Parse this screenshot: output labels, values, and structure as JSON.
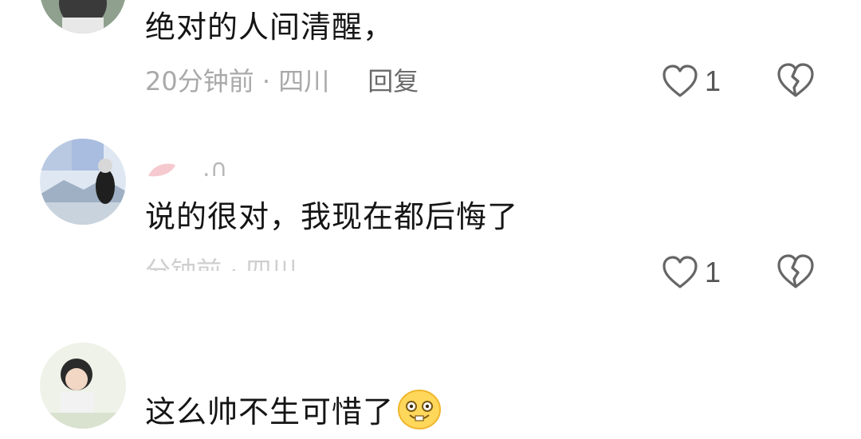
{
  "comments": [
    {
      "text": "绝对的人间清醒，",
      "time": "20分钟前",
      "location": "四川",
      "separator": " · ",
      "reply_label": "回复",
      "like_count": "1"
    },
    {
      "username": " .∩",
      "text": "说的很对，我现在都后悔了",
      "time": "分钟前",
      "location": "四川",
      "separator": " · ",
      "like_count": "1"
    },
    {
      "text": "这么帅不生可惜了",
      "emoji": "grinning-emoji"
    }
  ],
  "icons": {
    "like": "heart-outline-icon",
    "dislike": "broken-heart-outline-icon"
  },
  "colors": {
    "text": "#151515",
    "meta": "#a9a9a9",
    "reply": "#6b6b6b",
    "icon": "#666666"
  }
}
